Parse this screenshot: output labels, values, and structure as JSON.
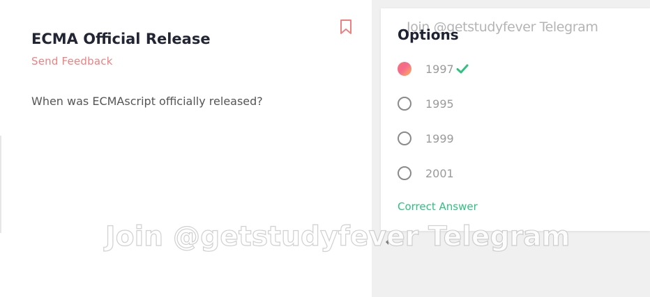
{
  "question_card": {
    "title": "ECMA Official Release",
    "feedback_label": "Send Feedback",
    "question_text": "When was ECMAscript officially released?",
    "bookmark_icon": "bookmark-icon",
    "accent_color": "#f08080"
  },
  "options_panel": {
    "title": "Options",
    "options": [
      {
        "label": "1997",
        "selected": true,
        "correct": true
      },
      {
        "label": "1995",
        "selected": false,
        "correct": false
      },
      {
        "label": "1999",
        "selected": false,
        "correct": false
      },
      {
        "label": "2001",
        "selected": false,
        "correct": false
      }
    ],
    "result_label": "Correct Answer",
    "result_color": "#2ec27e"
  },
  "watermarks": {
    "top": "Join @getstudyfever Telegram",
    "center": "Join @getstudyfever Telegram"
  }
}
